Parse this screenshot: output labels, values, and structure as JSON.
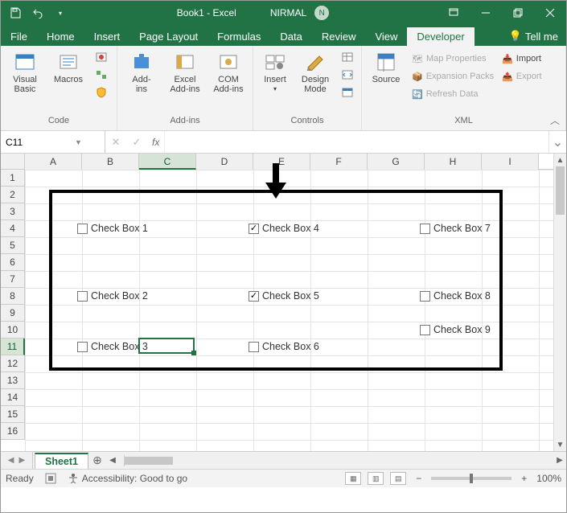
{
  "title": {
    "doc": "Book1 - Excel",
    "user": "NIRMAL",
    "initial": "N"
  },
  "tabs": [
    "File",
    "Home",
    "Insert",
    "Page Layout",
    "Formulas",
    "Data",
    "Review",
    "View",
    "Developer"
  ],
  "active_tab": "Developer",
  "tellme": "Tell me",
  "ribbon": {
    "code": {
      "vb": "Visual\nBasic",
      "macros": "Macros",
      "label": "Code"
    },
    "addins": {
      "addins": "Add-\nins",
      "excel": "Excel\nAdd-ins",
      "com": "COM\nAdd-ins",
      "label": "Add-ins"
    },
    "controls": {
      "insert": "Insert",
      "design": "Design\nMode",
      "label": "Controls"
    },
    "xml": {
      "source": "Source",
      "map": "Map Properties",
      "exp": "Expansion Packs",
      "refresh": "Refresh Data",
      "import": "Import",
      "export": "Export",
      "label": "XML"
    }
  },
  "namebox": "C11",
  "columns": [
    "A",
    "B",
    "C",
    "D",
    "E",
    "F",
    "G",
    "H",
    "I"
  ],
  "rows": [
    "1",
    "2",
    "3",
    "4",
    "5",
    "6",
    "7",
    "8",
    "9",
    "10",
    "11",
    "12",
    "13",
    "14",
    "15",
    "16"
  ],
  "active_col": "C",
  "active_row": "11",
  "checkboxes": [
    {
      "label": "Check Box 1",
      "checked": false,
      "col": 1,
      "row": 3
    },
    {
      "label": "Check Box 2",
      "checked": false,
      "col": 1,
      "row": 7
    },
    {
      "label": "Check Box 3",
      "checked": false,
      "col": 1,
      "row": 10
    },
    {
      "label": "Check Box 4",
      "checked": true,
      "col": 4,
      "row": 3
    },
    {
      "label": "Check Box 5",
      "checked": true,
      "col": 4,
      "row": 7
    },
    {
      "label": "Check Box 6",
      "checked": false,
      "col": 4,
      "row": 10
    },
    {
      "label": "Check Box 7",
      "checked": false,
      "col": 7,
      "row": 3
    },
    {
      "label": "Check Box 8",
      "checked": false,
      "col": 7,
      "row": 7
    },
    {
      "label": "Check Box 9",
      "checked": false,
      "col": 7,
      "row": 9
    }
  ],
  "sheet": "Sheet1",
  "status": {
    "ready": "Ready",
    "acc": "Accessibility: Good to go",
    "zoom": "100%"
  }
}
